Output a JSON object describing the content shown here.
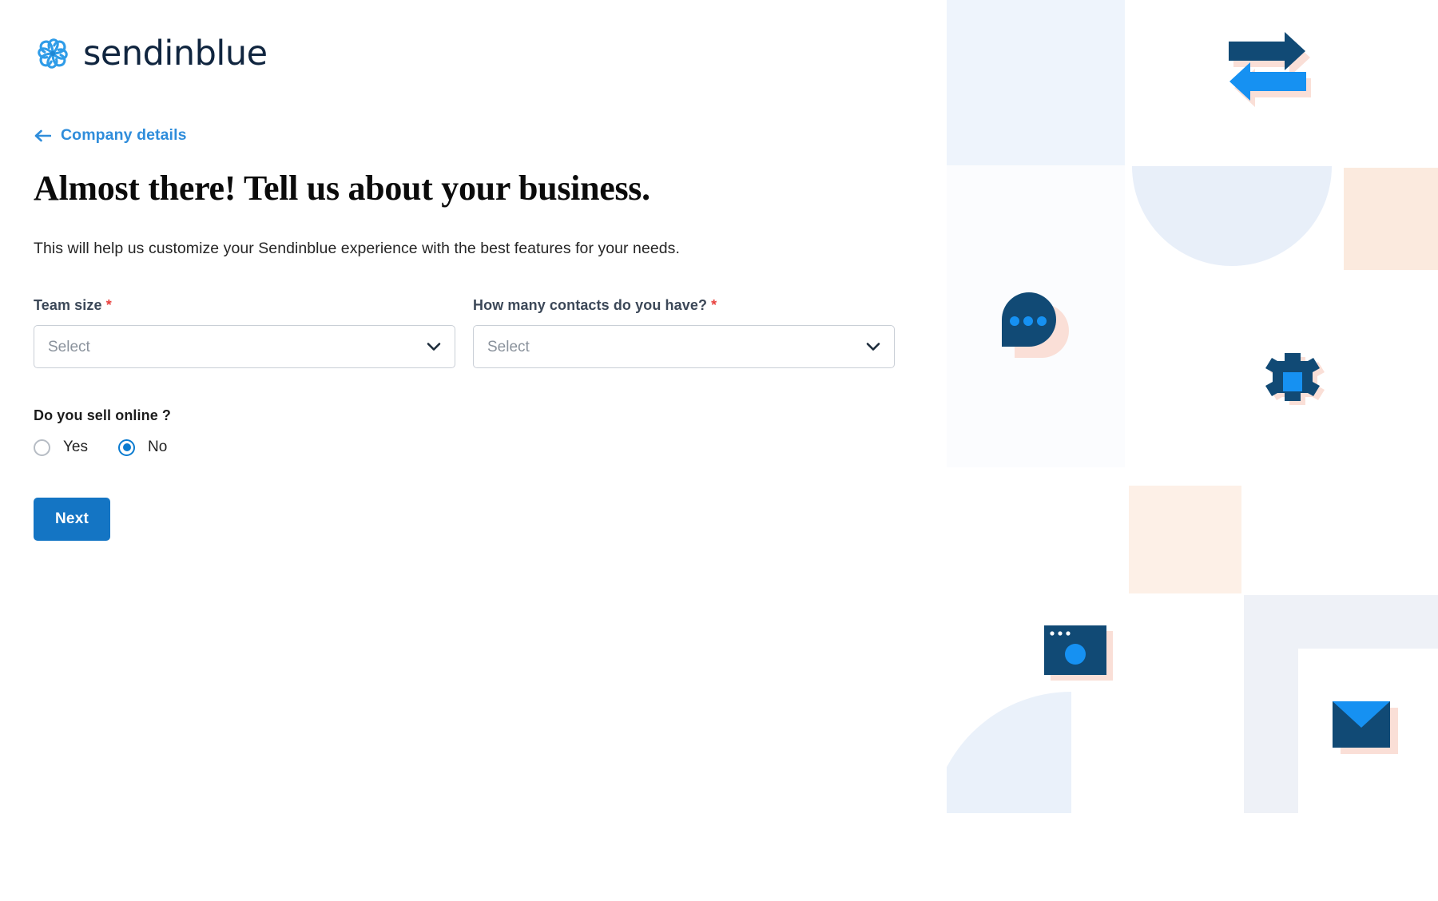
{
  "brand": {
    "logo_icon": "sendinblue-pinwheel-icon",
    "wordmark": "sendinblue",
    "colors": {
      "link_blue": "#2f8ddb",
      "button_blue": "#1475c4",
      "radio_blue": "#0a7bd0",
      "icon_navy": "#114a75",
      "icon_bright_blue": "#1691f2",
      "icon_shadow_pink": "#fadfd7",
      "required_red": "#e8423f",
      "label_grey": "#3c4858",
      "placeholder_grey": "#8a929c",
      "border_grey": "#c9cfd6"
    }
  },
  "back_link": {
    "icon": "arrow-left-icon",
    "label": "Company details"
  },
  "header": {
    "title": "Almost there! Tell us about your business.",
    "subtitle": "This will help us customize your Sendinblue experience with the best features for your needs."
  },
  "form": {
    "fields": [
      {
        "name": "team-size",
        "label": "Team size",
        "required": true,
        "required_marker": "*",
        "value": "",
        "placeholder": "Select",
        "chevron_icon": "chevron-down-icon"
      },
      {
        "name": "contacts-count",
        "label": "How many contacts do you have?",
        "required": true,
        "required_marker": "*",
        "value": "",
        "placeholder": "Select",
        "chevron_icon": "chevron-down-icon"
      }
    ],
    "radio_group": {
      "question": "Do you sell online ?",
      "options": [
        {
          "label": "Yes",
          "checked": false
        },
        {
          "label": "No",
          "checked": true
        }
      ]
    },
    "submit": {
      "label": "Next"
    }
  },
  "decoration": {
    "icons": [
      {
        "name": "exchange-arrows-icon"
      },
      {
        "name": "speech-bubble-icon"
      },
      {
        "name": "gear-icon"
      },
      {
        "name": "browser-window-icon"
      },
      {
        "name": "envelope-icon"
      }
    ]
  }
}
